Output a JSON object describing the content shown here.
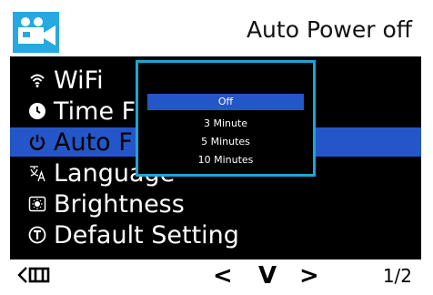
{
  "header": {
    "title": "Auto Power off",
    "icon": "video-camera-icon"
  },
  "menu": {
    "items": [
      {
        "label": "WiFi",
        "icon": "wifi-icon"
      },
      {
        "label": "Time F",
        "icon": "clock-icon"
      },
      {
        "label": "Auto F",
        "icon": "power-icon"
      },
      {
        "label": "Language",
        "icon": "language-icon"
      },
      {
        "label": "Brightness",
        "icon": "brightness-icon"
      },
      {
        "label": "Default Setting",
        "icon": "reset-icon"
      }
    ],
    "selected_index": 2
  },
  "popup": {
    "options": [
      "Off",
      "3 Minute",
      "5 Minutes",
      "10 Minutes"
    ],
    "selected_index": 0
  },
  "footer": {
    "back_icon": "back-icon",
    "prev_symbol": "<",
    "down_symbol": "V",
    "next_symbol": ">",
    "page": "1/2"
  },
  "colors": {
    "accent_blue": "#2456c9",
    "camera_icon_blue": "#28a8e0",
    "popup_border": "#1aa6d8"
  }
}
